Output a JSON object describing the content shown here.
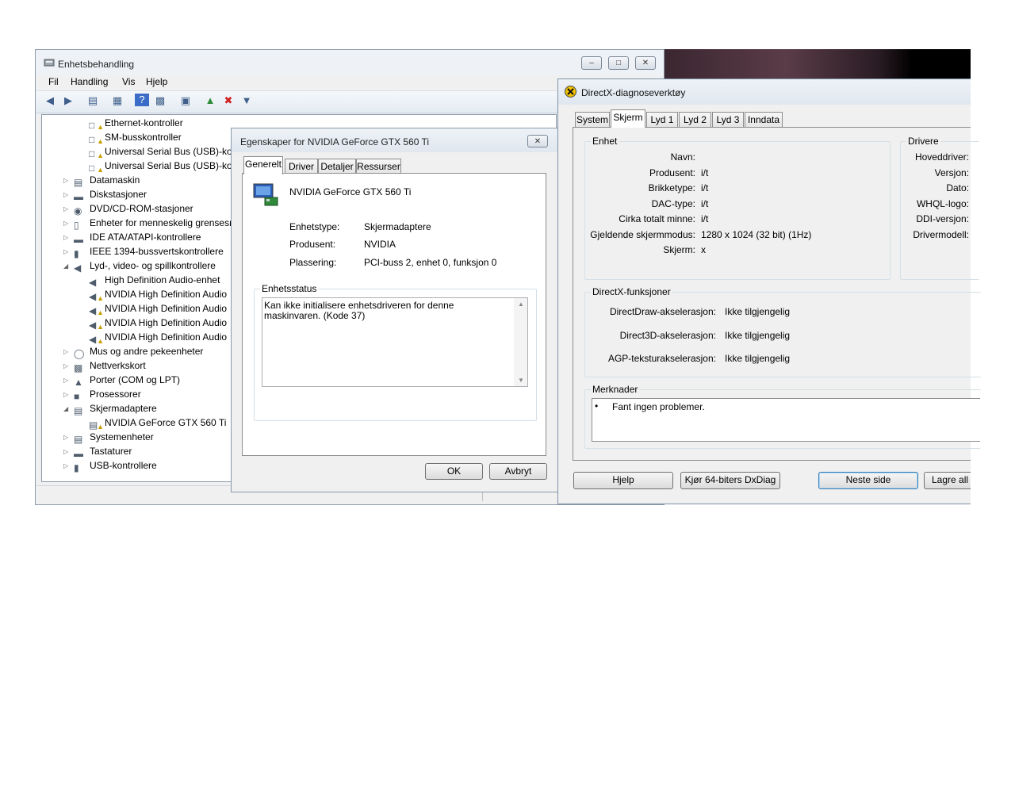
{
  "devmgr": {
    "title": "Enhetsbehandling",
    "menu": [
      "Fil",
      "Handling",
      "Vis",
      "Hjelp"
    ],
    "tree": [
      {
        "label": "Ethernet-kontroller",
        "level": 2,
        "icon": "warning-device-icon"
      },
      {
        "label": "SM-busskontroller",
        "level": 2,
        "icon": "warning-device-icon"
      },
      {
        "label": "Universal Serial Bus (USB)-kon",
        "level": 2,
        "icon": "warning-device-icon"
      },
      {
        "label": "Universal Serial Bus (USB)-kon",
        "level": 2,
        "icon": "warning-device-icon"
      },
      {
        "label": "Datamaskin",
        "level": 1,
        "icon": "computer-icon"
      },
      {
        "label": "Diskstasjoner",
        "level": 1,
        "icon": "disk-drive-icon"
      },
      {
        "label": "DVD/CD-ROM-stasjoner",
        "level": 1,
        "icon": "dvd-drive-icon"
      },
      {
        "label": "Enheter for menneskelig grensesn",
        "level": 1,
        "icon": "hid-icon"
      },
      {
        "label": "IDE ATA/ATAPI-kontrollere",
        "level": 1,
        "icon": "ide-icon"
      },
      {
        "label": "IEEE 1394-bussvertskontrollere",
        "level": 1,
        "icon": "firewire-icon"
      },
      {
        "label": "Lyd-, video- og spillkontrollere",
        "level": 1,
        "icon": "speaker-icon",
        "expanded": true
      },
      {
        "label": "High Definition Audio-enhet",
        "level": 2,
        "icon": "speaker-icon"
      },
      {
        "label": "NVIDIA High Definition Audio",
        "level": 2,
        "icon": "speaker-warning-icon"
      },
      {
        "label": "NVIDIA High Definition Audio",
        "level": 2,
        "icon": "speaker-warning-icon"
      },
      {
        "label": "NVIDIA High Definition Audio",
        "level": 2,
        "icon": "speaker-warning-icon"
      },
      {
        "label": "NVIDIA High Definition Audio",
        "level": 2,
        "icon": "speaker-warning-icon"
      },
      {
        "label": "Mus og andre pekeenheter",
        "level": 1,
        "icon": "mouse-icon"
      },
      {
        "label": "Nettverkskort",
        "level": 1,
        "icon": "network-icon"
      },
      {
        "label": "Porter (COM og LPT)",
        "level": 1,
        "icon": "port-icon"
      },
      {
        "label": "Prosessorer",
        "level": 1,
        "icon": "processor-icon"
      },
      {
        "label": "Skjermadaptere",
        "level": 1,
        "icon": "display-adapter-icon",
        "expanded": true
      },
      {
        "label": "NVIDIA GeForce GTX 560 Ti",
        "level": 2,
        "icon": "display-warning-icon"
      },
      {
        "label": "Systemenheter",
        "level": 1,
        "icon": "computer-icon"
      },
      {
        "label": "Tastaturer",
        "level": 1,
        "icon": "keyboard-icon"
      },
      {
        "label": "USB-kontrollere",
        "level": 1,
        "icon": "usb-icon"
      }
    ]
  },
  "props": {
    "title": "Egenskaper for NVIDIA GeForce GTX 560 Ti",
    "tabs": [
      "Generelt",
      "Driver",
      "Detaljer",
      "Ressurser"
    ],
    "device_name": "NVIDIA GeForce GTX 560 Ti",
    "fields": [
      {
        "label": "Enhetstype:",
        "value": "Skjermadaptere"
      },
      {
        "label": "Produsent:",
        "value": "NVIDIA"
      },
      {
        "label": "Plassering:",
        "value": "PCI-buss 2, enhet 0, funksjon 0"
      }
    ],
    "status_group": "Enhetsstatus",
    "status_text": "Kan ikke initialisere enhetsdriveren for denne maskinvaren. (Kode 37)",
    "ok": "OK",
    "cancel": "Avbryt"
  },
  "dxdiag": {
    "title": "DirectX-diagnoseverktøy",
    "tabs": [
      "System",
      "Skjerm",
      "Lyd 1",
      "Lyd 2",
      "Lyd 3",
      "Inndata"
    ],
    "device_group": "Enhet",
    "device_fields": [
      {
        "label": "Navn:",
        "value": ""
      },
      {
        "label": "Produsent:",
        "value": "i/t"
      },
      {
        "label": "Brikketype:",
        "value": "i/t"
      },
      {
        "label": "DAC-type:",
        "value": "i/t"
      },
      {
        "label": "Cirka totalt minne:",
        "value": "i/t"
      },
      {
        "label": "Gjeldende skjermmodus:",
        "value": "1280 x 1024 (32 bit) (1Hz)"
      },
      {
        "label": "Skjerm:",
        "value": "x"
      }
    ],
    "drivers_group": "Drivere",
    "driver_fields": [
      "Hoveddriver:",
      "Versjon:",
      "Dato:",
      "WHQL-logo:",
      "DDI-versjon:",
      "Drivermodell:"
    ],
    "features_group": "DirectX-funksjoner",
    "features": [
      {
        "label": "DirectDraw-akselerasjon:",
        "value": "Ikke tilgjengelig"
      },
      {
        "label": "Direct3D-akselerasjon:",
        "value": "Ikke tilgjengelig"
      },
      {
        "label": "AGP-teksturakselerasjon:",
        "value": "Ikke tilgjengelig"
      }
    ],
    "notes_group": "Merknader",
    "notes": [
      "Fant ingen problemer."
    ],
    "buttons": {
      "help": "Hjelp",
      "run64": "Kjør 64-biters DxDiag",
      "next": "Neste side",
      "save": "Lagre all in"
    }
  }
}
